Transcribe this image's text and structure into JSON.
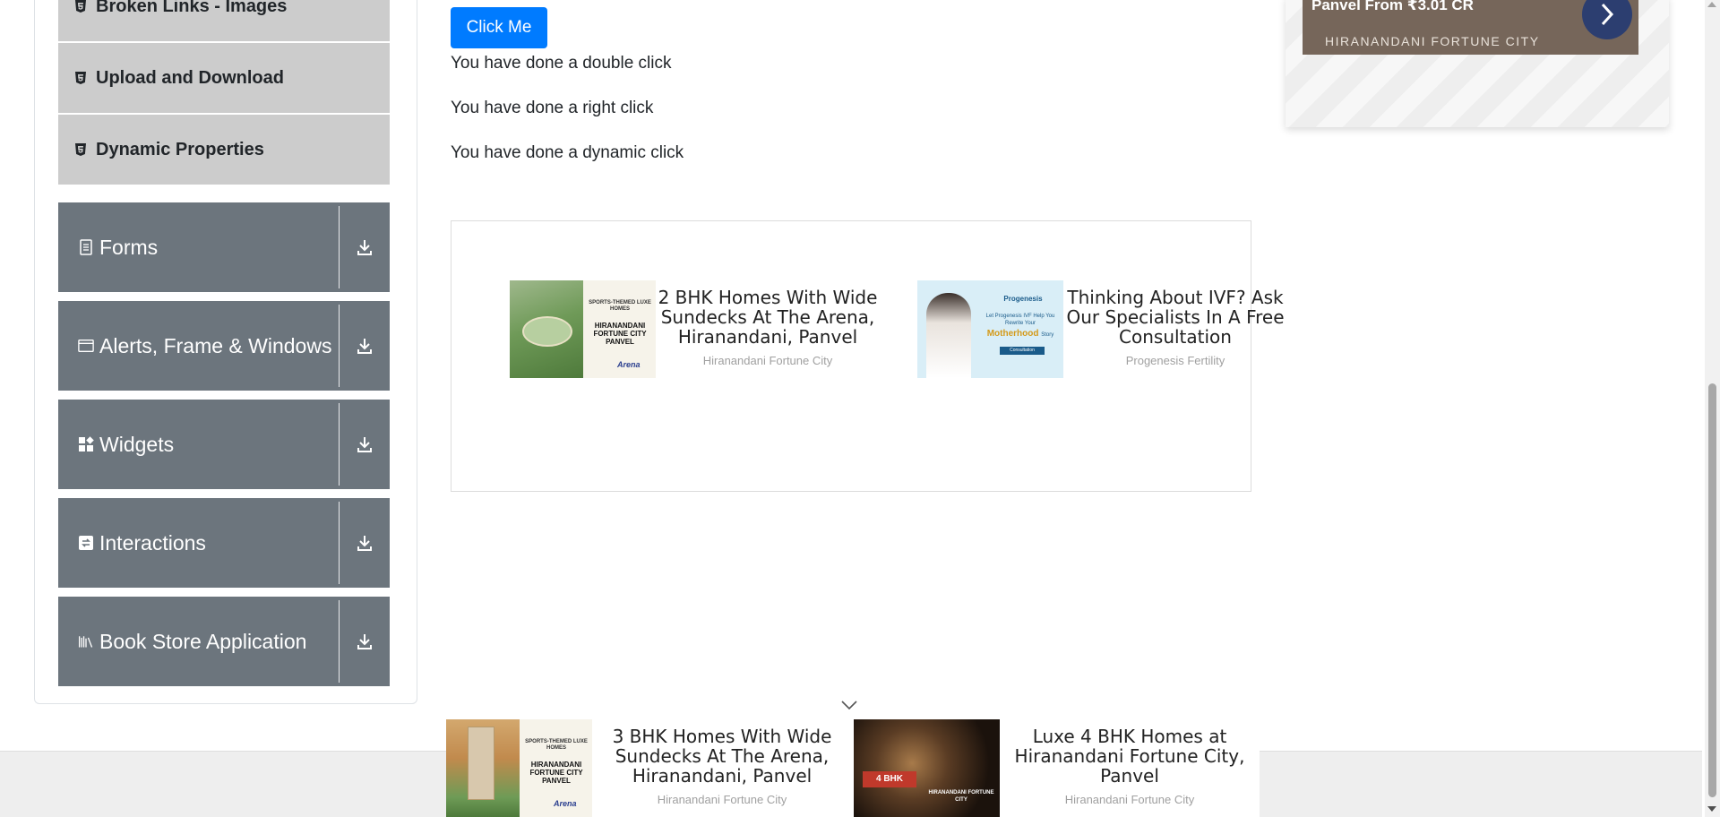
{
  "sidebar": {
    "sub_items": [
      {
        "label": "Broken Links - Images"
      },
      {
        "label": "Upload and Download"
      },
      {
        "label": "Dynamic Properties"
      }
    ],
    "groups": [
      {
        "label": "Forms",
        "icon": "document-icon"
      },
      {
        "label": "Alerts, Frame & Windows",
        "icon": "window-icon"
      },
      {
        "label": "Widgets",
        "icon": "widgets-icon"
      },
      {
        "label": "Interactions",
        "icon": "interactions-icon"
      },
      {
        "label": "Book Store Application",
        "icon": "books-icon"
      }
    ]
  },
  "main": {
    "click_button_label": "Click Me",
    "messages": [
      "You have done a double click",
      "You have done a right click",
      "You have done a dynamic click"
    ]
  },
  "ads_inline": [
    {
      "title": "2 BHK Homes With Wide Sundecks At The Arena, Hiranandani, Panvel",
      "source": "Hiranandani Fortune City"
    },
    {
      "title": "Thinking About IVF? Ask Our Specialists In A Free Consultation",
      "source": "Progenesis Fertility"
    }
  ],
  "ad_top_right": {
    "headline": "Panvel From ₹3.01 CR",
    "brand": "HIRANANDANI FORTUNE CITY"
  },
  "ads_bottom": [
    {
      "title": "3 BHK Homes With Wide Sundecks At The Arena, Hiranandani, Panvel",
      "source": "Hiranandani Fortune City"
    },
    {
      "title": "Luxe 4 BHK Homes at Hiranandani Fortune City, Panvel",
      "source": "Hiranandani Fortune City"
    }
  ],
  "ad_images": {
    "hiranandani_1": {
      "tagline": "SPORTS-THEMED LUXE HOMES",
      "brand": "HIRANANDANI FORTUNE CITY PANVEL",
      "logo": "Arena"
    },
    "progenesis": {
      "logo": "Progenesis",
      "line1": "Let Progenesis IVF Help You Rewrite Your",
      "highlight": "Motherhood",
      "line2": "Story",
      "cta": "Consultation"
    },
    "hiranandani_2": {
      "tagline": "SPORTS-THEMED LUXE HOMES",
      "brand": "HIRANANDANI FORTUNE CITY PANVEL",
      "logo": "Arena"
    },
    "hiranandani_3": {
      "badge": "4 BHK",
      "brand": "HIRANANDANI FORTUNE CITY"
    }
  },
  "colors": {
    "primary_button": "#007bff",
    "group_bg": "#6c757d",
    "sub_item_bg": "#cccccc"
  }
}
